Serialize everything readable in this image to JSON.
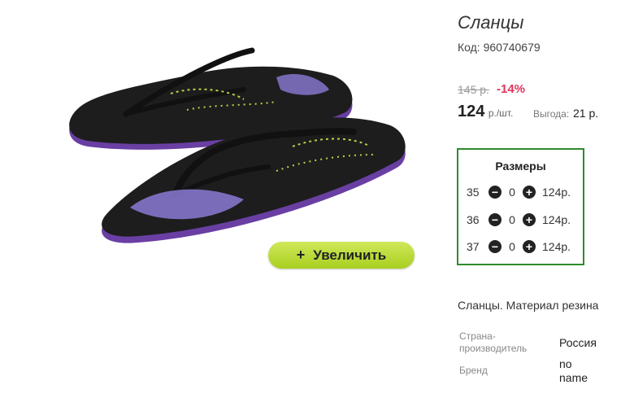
{
  "product": {
    "title": "Сланцы",
    "code": "Код: 960740679",
    "old_price": "145 р.",
    "discount": "-14%",
    "price": "124",
    "unit": "р./шт.",
    "benefit_label": "Выгода:",
    "benefit_value": "21 р.",
    "zoom_button": "Увеличить",
    "zoom_plus": "+"
  },
  "sizes": {
    "title": "Размеры",
    "items": [
      {
        "size": "35",
        "qty": "0",
        "price": "124р."
      },
      {
        "size": "36",
        "qty": "0",
        "price": "124р."
      },
      {
        "size": "37",
        "qty": "0",
        "price": "124р."
      }
    ]
  },
  "description": "Сланцы. Материал резина",
  "specs": {
    "country_label_1": "Страна-",
    "country_label_2": "производитель",
    "country_value": "Россия",
    "brand_label": "Бренд",
    "brand_value_1": "no",
    "brand_value_2": "name"
  }
}
